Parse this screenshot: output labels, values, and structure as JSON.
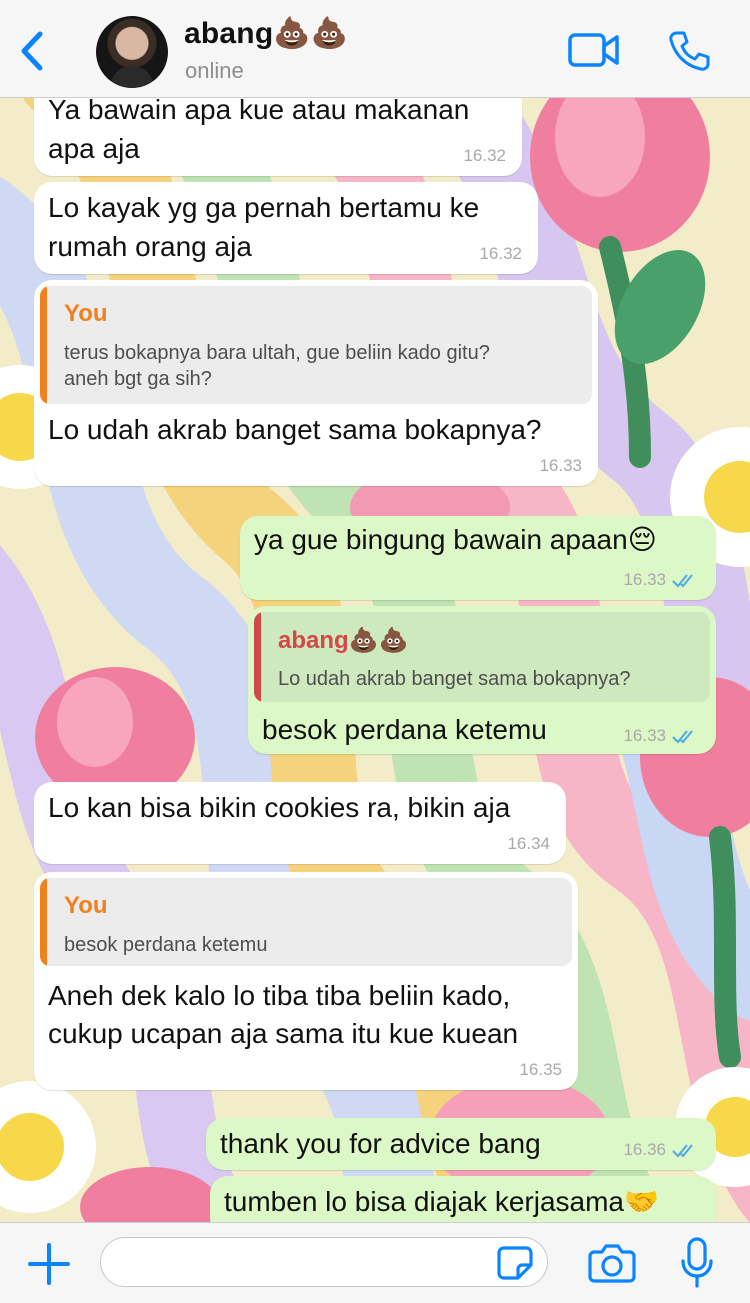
{
  "contact": {
    "name": "abang💩💩",
    "status": "online"
  },
  "colors": {
    "accent": "#0a84ff",
    "outgoing_bubble": "#dcf8c6",
    "incoming_bubble": "#ffffff",
    "quote_you": "#f0821e",
    "quote_abang": "#d04848",
    "read_ticks": "#4fa9e8"
  },
  "icons": {
    "back": "chevron-left-icon",
    "video": "video-camera-icon",
    "call": "phone-icon",
    "add": "plus-icon",
    "sticker": "sticker-icon",
    "camera": "camera-icon",
    "mic": "microphone-icon"
  },
  "messages": [
    {
      "dir": "in",
      "lines": [
        "Ya bawain apa kue atau makanan",
        "apa aja"
      ],
      "time": "16.32"
    },
    {
      "dir": "in",
      "lines": [
        "Lo kayak yg ga pernah bertamu ke",
        "rumah orang aja"
      ],
      "time": "16.32"
    },
    {
      "dir": "in",
      "quote": {
        "author": "You",
        "lines": [
          "terus bokapnya bara ultah, gue beliin kado gitu?",
          "aneh bgt ga sih?"
        ]
      },
      "lines": [
        "Lo udah akrab banget sama bokapnya?"
      ],
      "time": "16.33"
    },
    {
      "dir": "out",
      "lines": [
        "ya gue bingung bawain apaan😔"
      ],
      "time": "16.33",
      "read": true
    },
    {
      "dir": "out",
      "quote": {
        "author": "abang💩💩",
        "lines": [
          "Lo udah akrab banget sama bokapnya?"
        ]
      },
      "lines": [
        "besok perdana ketemu"
      ],
      "time": "16.33",
      "read": true
    },
    {
      "dir": "in",
      "lines": [
        "Lo kan bisa bikin cookies ra, bikin aja"
      ],
      "time": "16.34"
    },
    {
      "dir": "in",
      "quote": {
        "author": "You",
        "lines": [
          "besok perdana ketemu"
        ]
      },
      "lines": [
        "Aneh dek kalo lo tiba tiba beliin kado,",
        "cukup ucapan aja sama itu kue kuean"
      ],
      "time": "16.35"
    },
    {
      "dir": "out",
      "lines": [
        "thank you for advice bang"
      ],
      "time": "16.36",
      "read": true
    },
    {
      "dir": "out",
      "lines": [
        "tumben lo bisa diajak kerjasama🤝"
      ]
    }
  ],
  "composer": {
    "value": "",
    "placeholder": ""
  }
}
